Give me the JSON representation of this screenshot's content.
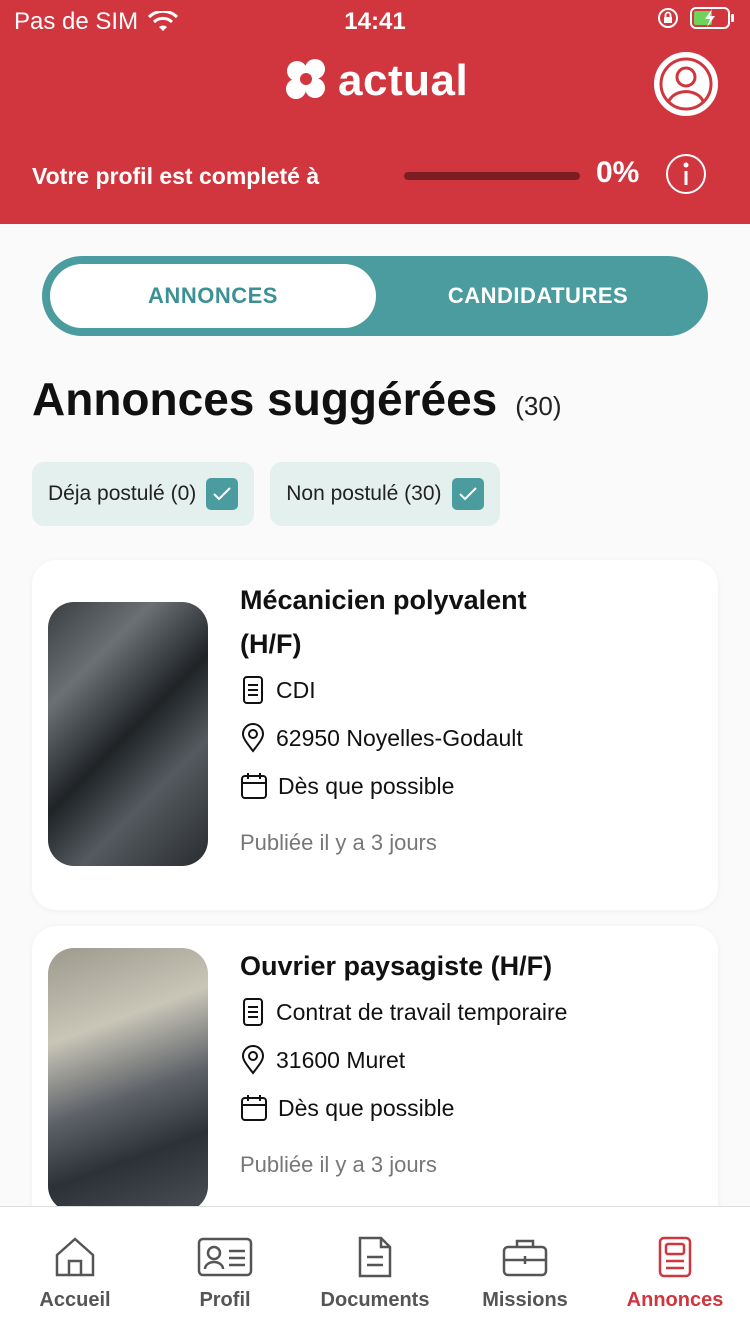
{
  "status_bar": {
    "carrier": "Pas de SIM",
    "time": "14:41"
  },
  "header": {
    "brand": "actual",
    "profile_text": "Votre profil est completé à",
    "profile_percent": "0%",
    "profile_progress": 0,
    "accent_color": "#d1353d"
  },
  "tabs": {
    "annonces": "ANNONCES",
    "candidatures": "CANDIDATURES",
    "active": "ANNONCES"
  },
  "section": {
    "title": "Annonces suggérées",
    "count": "(30)"
  },
  "filters": [
    {
      "label": "Déja postulé (0)",
      "checked": true
    },
    {
      "label": "Non postulé (30)",
      "checked": true
    }
  ],
  "jobs": [
    {
      "title_line1": "Mécanicien polyvalent",
      "title_line2": "(H/F)",
      "contract": "CDI",
      "location": "62950 Noyelles-Godault",
      "start": "Dès que possible",
      "published": "Publiée il y a 3 jours",
      "image": "mechanic-photo"
    },
    {
      "title_line1": "Ouvrier paysagiste (H/F)",
      "contract": "Contrat de travail temporaire",
      "location": "31600 Muret",
      "start": "Dès que possible",
      "published": "Publiée il y a 3 jours",
      "image": "landscaper-photo"
    }
  ],
  "bottom_nav": [
    {
      "label": "Accueil",
      "icon": "home-icon"
    },
    {
      "label": "Profil",
      "icon": "id-card-icon"
    },
    {
      "label": "Documents",
      "icon": "document-icon"
    },
    {
      "label": "Missions",
      "icon": "briefcase-icon"
    },
    {
      "label": "Annonces",
      "icon": "annonces-icon",
      "active": true
    }
  ],
  "colors": {
    "teal": "#4a9c9e",
    "chip_bg": "#e3f0ee",
    "active_nav": "#d1353d"
  }
}
